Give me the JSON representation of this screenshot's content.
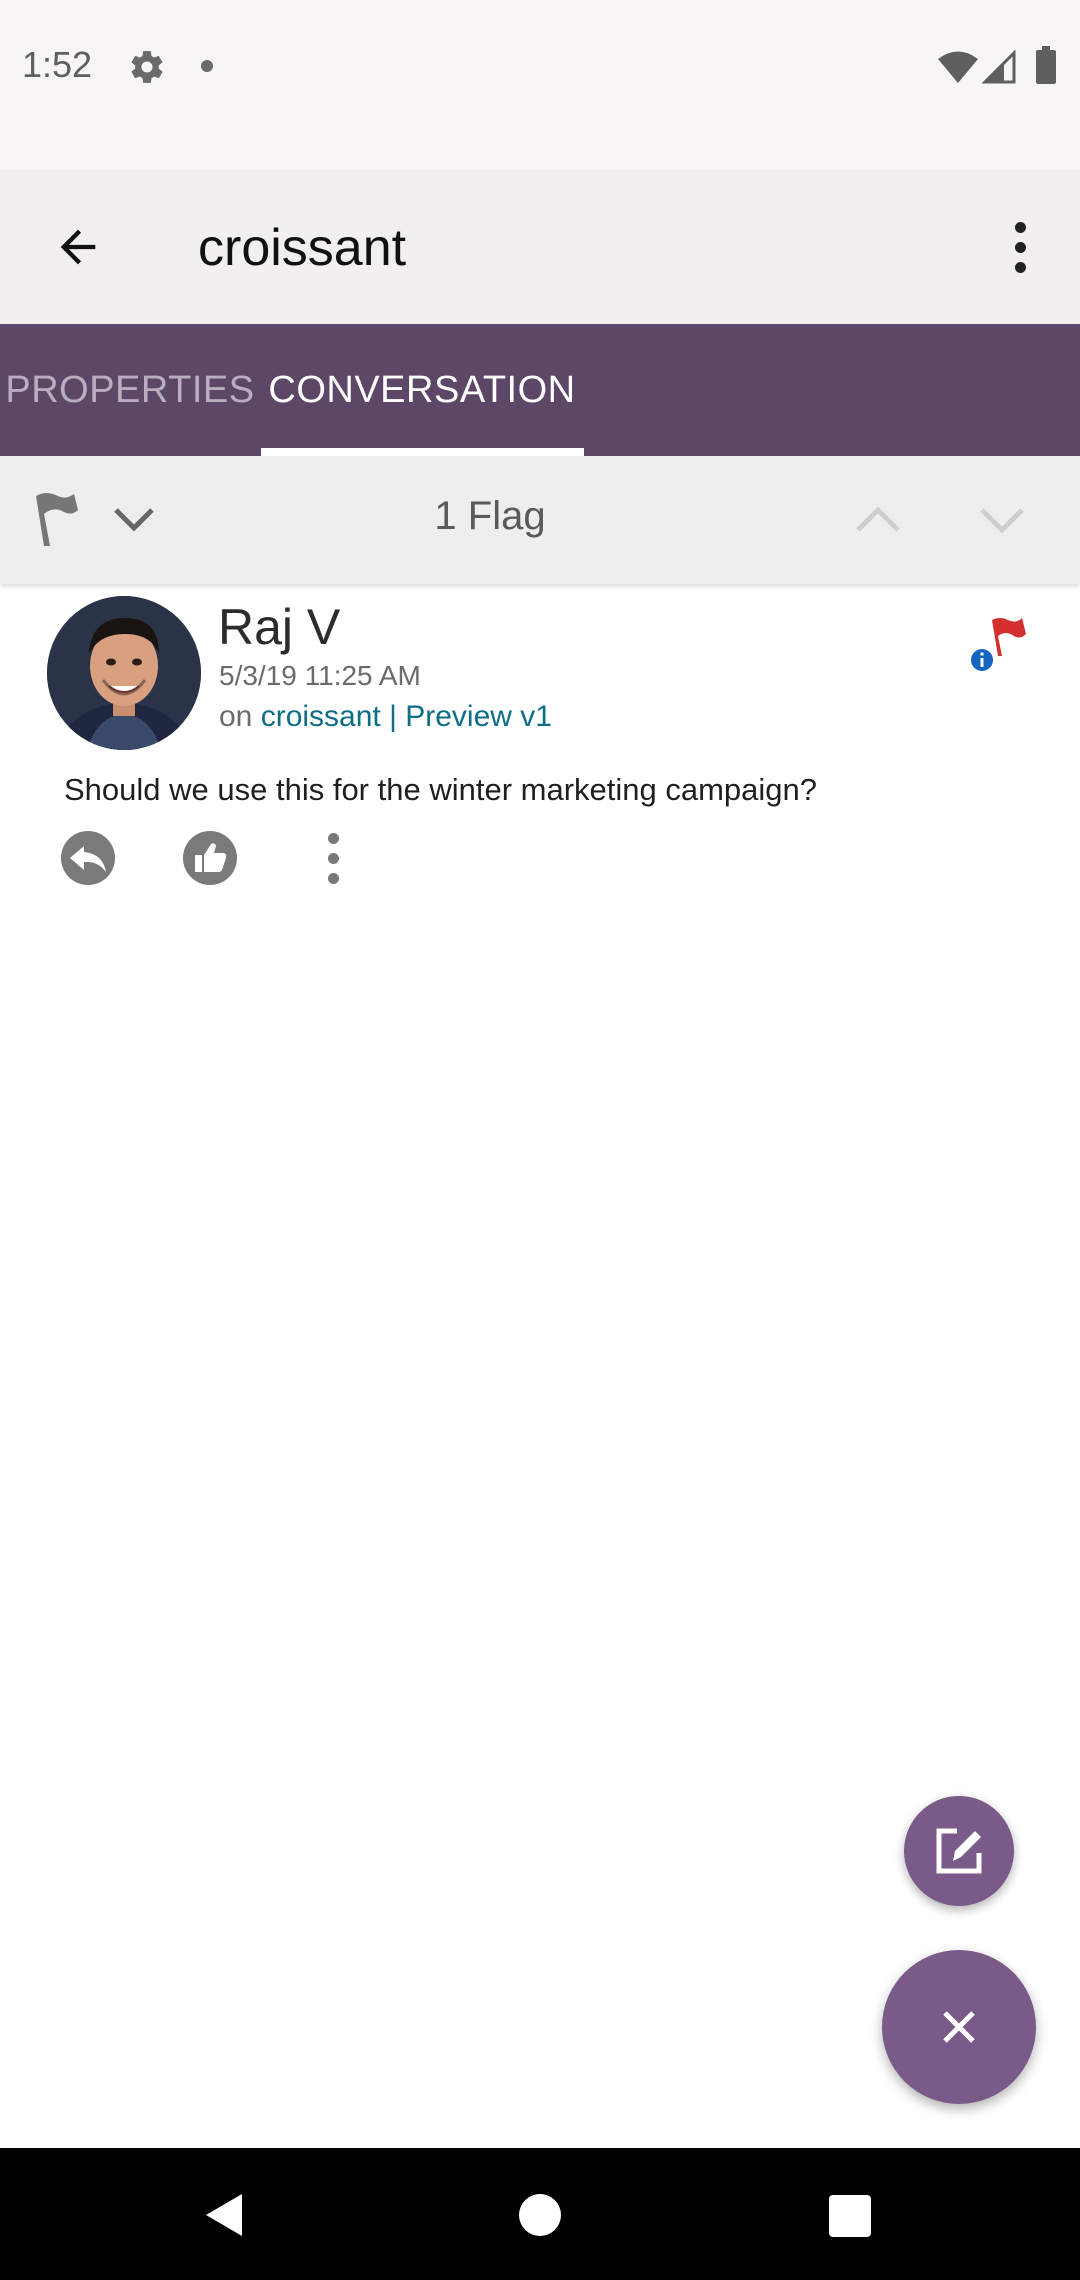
{
  "status_bar": {
    "time": "1:52"
  },
  "app_bar": {
    "title": "croissant"
  },
  "tabs": [
    {
      "label": "PROPERTIES",
      "selected": false
    },
    {
      "label": "CONVERSATION",
      "selected": true
    }
  ],
  "filter_bar": {
    "flag_count": "1 Flag"
  },
  "comment": {
    "author": "Raj V",
    "timestamp": "5/3/19 11:25 AM",
    "context_prefix": "on",
    "context_link": "croissant | Preview v1",
    "text": "Should we use this for the winter marketing campaign?"
  },
  "icons": {
    "back": "arrow-back-icon",
    "overflow": "more-vert-icon",
    "flag_filter": "flag-icon",
    "reply": "reply-icon",
    "like": "thumb-up-icon",
    "compose": "compose-icon",
    "close": "close-icon"
  },
  "colors": {
    "tab_bar": "#5c4766",
    "accent": "#7a5a88",
    "link": "#0d6e86",
    "flag": "#d32f2f",
    "info": "#1565c0"
  }
}
